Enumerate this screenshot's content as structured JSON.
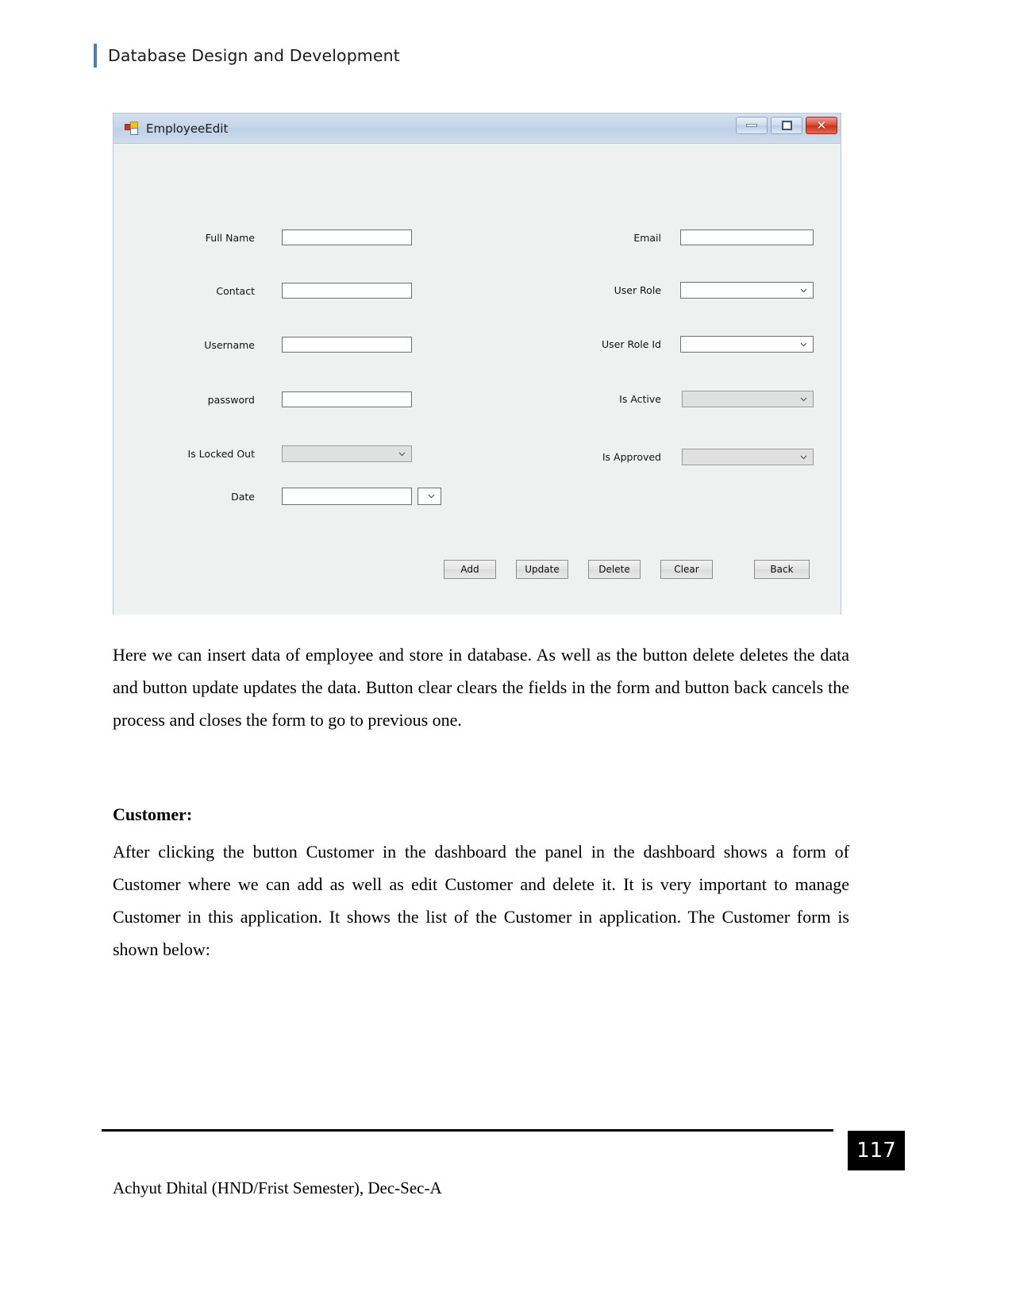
{
  "header": {
    "title": "Database Design and Development"
  },
  "winform": {
    "title": "EmployeeEdit",
    "icon": "visual-studio-form-icon",
    "window_controls": {
      "minimize": "minimize-icon",
      "maximize": "maximize-icon",
      "close": "✕"
    },
    "fields_left": [
      {
        "label": "Full Name",
        "type": "textbox",
        "value": "",
        "enabled": true
      },
      {
        "label": "Contact",
        "type": "textbox",
        "value": "",
        "enabled": true
      },
      {
        "label": "Username",
        "type": "textbox",
        "value": "",
        "enabled": true
      },
      {
        "label": "password",
        "type": "textbox",
        "value": "",
        "enabled": true
      },
      {
        "label": "Is Locked Out",
        "type": "combobox",
        "value": "",
        "enabled": false
      },
      {
        "label": "Date",
        "type": "datepicker",
        "value": "",
        "enabled": true
      }
    ],
    "fields_right": [
      {
        "label": "Email",
        "type": "textbox",
        "value": "",
        "enabled": true
      },
      {
        "label": "User Role",
        "type": "combobox",
        "value": "",
        "enabled": true
      },
      {
        "label": "User Role Id",
        "type": "combobox",
        "value": "",
        "enabled": true
      },
      {
        "label": "Is Active",
        "type": "combobox",
        "value": "",
        "enabled": false
      },
      {
        "label": "Is Approved",
        "type": "combobox",
        "value": "",
        "enabled": false
      }
    ],
    "buttons": [
      {
        "label": "Add"
      },
      {
        "label": "Update"
      },
      {
        "label": "Delete"
      },
      {
        "label": "Clear"
      },
      {
        "label": "Back"
      }
    ]
  },
  "body": {
    "paragraph_1": "Here we can insert data of employee and store in database. As well as the button delete deletes the data and button update updates the data. Button clear clears the fields in the form and button back cancels the process and closes the form to go to previous one.",
    "heading_customer": "Customer:",
    "paragraph_2": "After clicking the button Customer in the dashboard the panel in the dashboard shows a form of Customer where we can add as well as edit Customer and delete it. It is very important to manage Customer in this application. It shows the list of the Customer in application. The Customer form is shown below:"
  },
  "footer": {
    "page_number": "117",
    "author_line": "Achyut Dhital (HND/Frist Semester), Dec-Sec-A"
  },
  "colors": {
    "header_accent": "#4a7ebb",
    "titlebar": "#c6d6e8",
    "close_button": "#dc4b37",
    "form_background": "#eff0f0",
    "page_badge": "#000000"
  }
}
